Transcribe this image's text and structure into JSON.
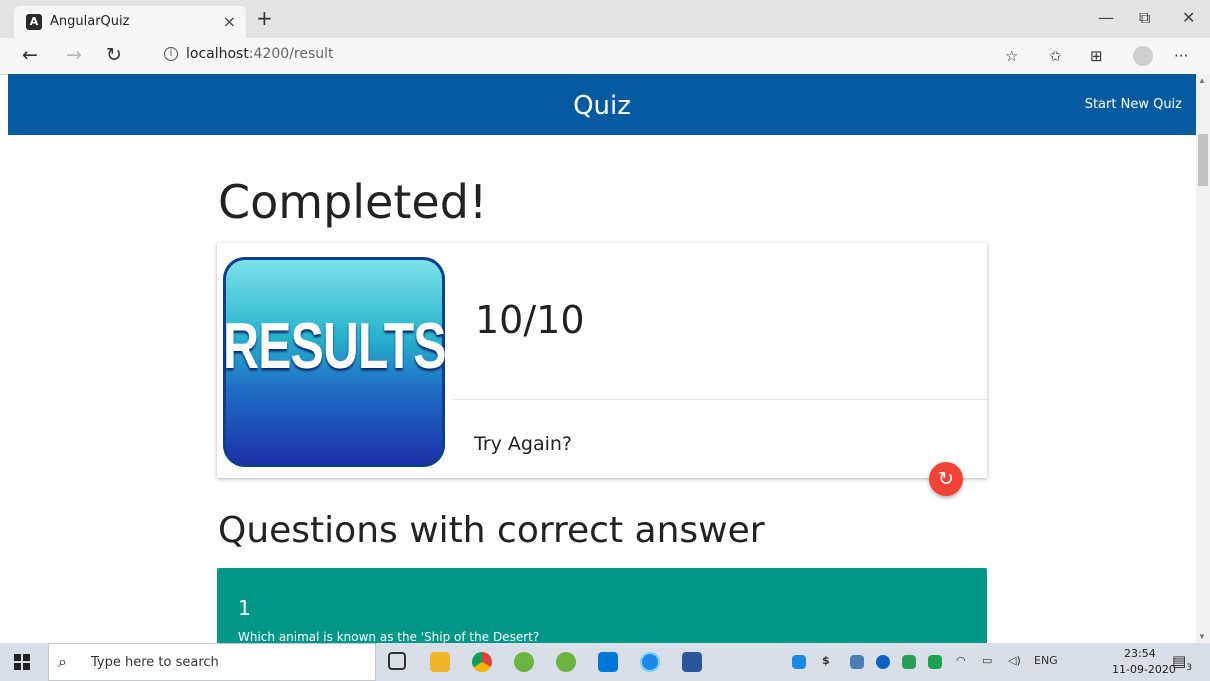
{
  "browser": {
    "tab_title": "AngularQuiz",
    "tab_favicon": "angular-logo",
    "new_tab_symbol": "+",
    "tab_close_symbol": "×",
    "url_host": "localhost",
    "url_rest": ":4200/result",
    "window_controls": {
      "minimize": "—",
      "restore": "⧉",
      "close": "✕"
    },
    "nav": {
      "back": "←",
      "forward": "→",
      "refresh": "↻"
    },
    "toolbar_icons": [
      "star-icon",
      "favorites-icon",
      "collections-icon",
      "profile-icon",
      "more-icon"
    ],
    "toolbar_symbols": {
      "star": "☆",
      "favorites": "✩",
      "collections": "⊞",
      "more": "···"
    }
  },
  "app": {
    "title": "Quiz",
    "start_new_quiz": "Start New Quiz",
    "header_color": "#055aa0"
  },
  "result": {
    "heading": "Completed!",
    "image_text": "RESULTS",
    "score": "10/10",
    "try_again": "Try Again?",
    "retry_symbol": "↻",
    "retry_color": "#f44336"
  },
  "questions_section": {
    "heading": "Questions with correct answer",
    "card_color": "#009688",
    "items": [
      {
        "number": "1",
        "text": "Which animal is known as the 'Ship of the Desert?"
      }
    ]
  },
  "taskbar": {
    "search_placeholder": "Type here to search",
    "apps": [
      "task-view-icon",
      "file-explorer-icon",
      "chrome-icon",
      "spring-tool-icon",
      "spring-tool-icon",
      "vscode-icon",
      "edge-icon",
      "word-icon"
    ],
    "tray_icons": [
      "cloud-icon",
      "dollar-icon",
      "app-icon",
      "onedrive-icon",
      "security-icon",
      "intellij-icon",
      "wifi-icon",
      "battery-icon",
      "volume-icon"
    ],
    "language": "ENG",
    "time": "23:54",
    "date": "11-09-2020",
    "notification_count": "3"
  }
}
